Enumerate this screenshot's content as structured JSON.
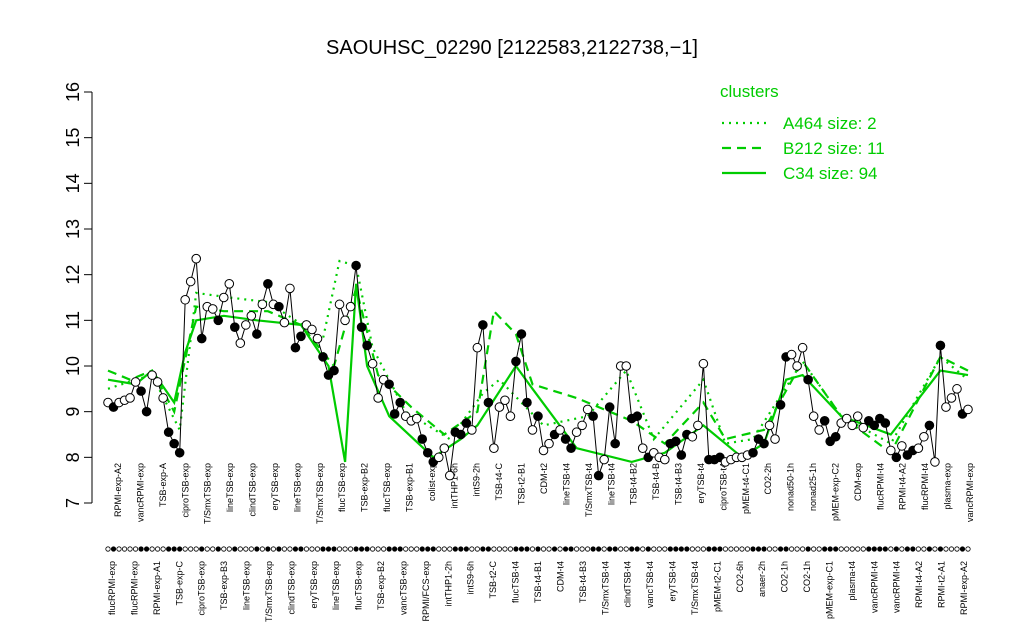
{
  "chart_data": {
    "type": "line",
    "title": "SAOUHSC_02290 [2122583,2122738,−1]",
    "xlabel": "",
    "ylabel": "",
    "ylim": [
      7,
      16
    ],
    "yticks": [
      "7",
      "8",
      "9",
      "10",
      "11",
      "12",
      "13",
      "14",
      "15",
      "16"
    ],
    "xtick_labels_lower": [
      "flucRPMI-exp",
      "flucRPMI-exp",
      "RPMI-exp-A1",
      "TSB-exp-C",
      "ciproTSB-exp",
      "TSB-exp-B3",
      "lineTSB-exp",
      "T/SmxTSB-exp",
      "clindTSB-exp",
      "eryTSB-exp",
      "lineTSB-exp",
      "flucTSB-exp",
      "TSB-exp-B2",
      "vancTSB-exp",
      "RPMI/FCS-exp",
      "intTHP1-2h",
      "intS9-6h",
      "TSB-t2-C",
      "flucTSB-t4",
      "TSB-t4-B1",
      "CDM-t4",
      "TSB-t4-B3",
      "T/SmxTSB-t4",
      "clindTSB-t4",
      "vancTSB-t4",
      "eryTSB-t4",
      "T/SmxTSB-t4",
      "pMEM-t2-C1",
      "CO2-6h",
      "anaer-2h",
      "CO2-1h",
      "CO2-1h",
      "pMEM-exp-C1",
      "plasma-t4",
      "vancRPMI-t4",
      "vancRPMI-t4",
      "RPMI-t4-A2",
      "RPMI-t2-A1",
      "RPMI-exp-A2"
    ],
    "xtick_labels_upper": [
      "RPMI-exp-A2",
      "vancRPMI-exp",
      "TSB-exp-A",
      "ciproTSB-exp",
      "T/SmxTSB-exp",
      "lineTSB-exp",
      "clindTSB-exp",
      "eryTSB-exp",
      "lineTSB-exp",
      "T/SmxTSB-exp",
      "flucTSB-exp",
      "TSB-exp-B2",
      "flucTSB-exp",
      "TSB-exp-B1",
      "colist-exp",
      "intTHP1-6h",
      "intS9-2h",
      "TSB-t4-C",
      "TSB-t2-B1",
      "CDM-t2",
      "lineTSB-t4",
      "T/SmxTSB-t4",
      "lineTSB-t4",
      "TSB-t4-B2",
      "TSB-t4-B",
      "TSB-t4-B3",
      "eryTSB-t4",
      "ciproTSB-t4",
      "pMEM-t4-C1",
      "CO2-2h",
      "nonad50-1h",
      "nonad25-1h",
      "pMEM-exp-C2",
      "CDM-exp",
      "flucRPMI-t4",
      "RPMI-t4-A2",
      "flucRPMI-t4",
      "plasma-exp",
      "vancRPMI-exp"
    ],
    "legend": {
      "title": "clusters",
      "position": "top-right",
      "entries": [
        {
          "label": "A464 size: 2",
          "style": "dotted",
          "color": "#00cc00"
        },
        {
          "label": "B212 size: 11",
          "style": "dashed",
          "color": "#00cc00"
        },
        {
          "label": "C34 size: 94",
          "style": "solid",
          "color": "#00cc00"
        }
      ]
    },
    "grid": false,
    "points": [
      [
        1,
        9.2,
        0
      ],
      [
        2,
        9.1,
        1
      ],
      [
        3,
        9.2,
        0
      ],
      [
        4,
        9.25,
        0
      ],
      [
        5,
        9.3,
        0
      ],
      [
        6,
        9.65,
        0
      ],
      [
        7,
        9.45,
        1
      ],
      [
        8,
        9.0,
        1
      ],
      [
        9,
        9.8,
        0
      ],
      [
        10,
        9.65,
        0
      ],
      [
        11,
        9.3,
        0
      ],
      [
        12,
        8.55,
        1
      ],
      [
        13,
        8.3,
        1
      ],
      [
        14,
        8.1,
        1
      ],
      [
        15,
        11.45,
        0
      ],
      [
        16,
        11.85,
        0
      ],
      [
        17,
        12.35,
        0
      ],
      [
        18,
        10.6,
        1
      ],
      [
        19,
        11.3,
        0
      ],
      [
        20,
        11.25,
        0
      ],
      [
        21,
        11.0,
        1
      ],
      [
        22,
        11.5,
        0
      ],
      [
        23,
        11.8,
        0
      ],
      [
        24,
        10.85,
        1
      ],
      [
        25,
        10.5,
        0
      ],
      [
        26,
        10.9,
        0
      ],
      [
        27,
        11.1,
        0
      ],
      [
        28,
        10.7,
        1
      ],
      [
        29,
        11.35,
        0
      ],
      [
        30,
        11.8,
        1
      ],
      [
        31,
        11.35,
        0
      ],
      [
        32,
        11.3,
        1
      ],
      [
        33,
        10.95,
        0
      ],
      [
        34,
        11.7,
        0
      ],
      [
        35,
        10.4,
        1
      ],
      [
        36,
        10.65,
        1
      ],
      [
        37,
        10.9,
        0
      ],
      [
        38,
        10.8,
        0
      ],
      [
        39,
        10.6,
        0
      ],
      [
        40,
        10.2,
        1
      ],
      [
        41,
        9.8,
        1
      ],
      [
        42,
        9.9,
        1
      ],
      [
        43,
        11.35,
        0
      ],
      [
        44,
        11.0,
        0
      ],
      [
        45,
        11.3,
        0
      ],
      [
        46,
        12.2,
        1
      ],
      [
        47,
        10.85,
        1
      ],
      [
        48,
        10.45,
        1
      ],
      [
        49,
        10.05,
        0
      ],
      [
        50,
        9.3,
        0
      ],
      [
        51,
        9.7,
        0
      ],
      [
        52,
        9.6,
        1
      ],
      [
        53,
        8.95,
        1
      ],
      [
        54,
        9.2,
        1
      ],
      [
        55,
        8.9,
        0
      ],
      [
        56,
        8.8,
        0
      ],
      [
        57,
        8.85,
        0
      ],
      [
        58,
        8.4,
        1
      ],
      [
        59,
        8.1,
        1
      ],
      [
        60,
        7.9,
        1
      ],
      [
        61,
        8.0,
        0
      ],
      [
        62,
        8.2,
        0
      ],
      [
        63,
        7.6,
        0
      ],
      [
        64,
        8.55,
        1
      ],
      [
        65,
        8.5,
        1
      ],
      [
        66,
        8.75,
        1
      ],
      [
        67,
        8.6,
        0
      ],
      [
        68,
        10.4,
        0
      ],
      [
        69,
        10.9,
        1
      ],
      [
        70,
        9.2,
        1
      ],
      [
        71,
        8.2,
        0
      ],
      [
        72,
        9.1,
        0
      ],
      [
        73,
        9.25,
        0
      ],
      [
        74,
        8.9,
        0
      ],
      [
        75,
        10.1,
        1
      ],
      [
        76,
        10.7,
        1
      ],
      [
        77,
        9.2,
        1
      ],
      [
        78,
        8.6,
        0
      ],
      [
        79,
        8.9,
        1
      ],
      [
        80,
        8.15,
        0
      ],
      [
        81,
        8.3,
        0
      ],
      [
        82,
        8.5,
        1
      ],
      [
        83,
        8.6,
        0
      ],
      [
        84,
        8.4,
        1
      ],
      [
        85,
        8.2,
        1
      ],
      [
        86,
        8.55,
        0
      ],
      [
        87,
        8.7,
        0
      ],
      [
        88,
        9.05,
        0
      ],
      [
        89,
        8.9,
        1
      ],
      [
        90,
        7.6,
        1
      ],
      [
        91,
        7.95,
        0
      ],
      [
        92,
        9.1,
        1
      ],
      [
        93,
        8.3,
        1
      ],
      [
        94,
        10.0,
        0
      ],
      [
        95,
        10.0,
        0
      ],
      [
        96,
        8.85,
        1
      ],
      [
        97,
        8.9,
        1
      ],
      [
        98,
        8.2,
        0
      ],
      [
        99,
        8.0,
        1
      ],
      [
        100,
        8.1,
        0
      ],
      [
        101,
        8.0,
        0
      ],
      [
        102,
        7.95,
        0
      ],
      [
        103,
        8.3,
        1
      ],
      [
        104,
        8.35,
        1
      ],
      [
        105,
        8.05,
        1
      ],
      [
        106,
        8.5,
        1
      ],
      [
        107,
        8.45,
        0
      ],
      [
        108,
        8.7,
        0
      ],
      [
        109,
        10.05,
        0
      ],
      [
        110,
        7.95,
        1
      ],
      [
        111,
        7.95,
        1
      ],
      [
        112,
        8.0,
        1
      ],
      [
        113,
        7.9,
        0
      ],
      [
        114,
        7.95,
        0
      ],
      [
        115,
        8.0,
        0
      ],
      [
        116,
        8.0,
        0
      ],
      [
        117,
        8.05,
        0
      ],
      [
        118,
        8.1,
        1
      ],
      [
        119,
        8.4,
        1
      ],
      [
        120,
        8.3,
        1
      ],
      [
        121,
        8.7,
        0
      ],
      [
        122,
        8.4,
        0
      ],
      [
        123,
        9.15,
        1
      ],
      [
        124,
        10.2,
        1
      ],
      [
        125,
        10.25,
        0
      ],
      [
        126,
        10.0,
        0
      ],
      [
        127,
        10.4,
        0
      ],
      [
        128,
        9.7,
        1
      ],
      [
        129,
        8.9,
        0
      ],
      [
        130,
        8.6,
        0
      ],
      [
        131,
        8.8,
        1
      ],
      [
        132,
        8.35,
        1
      ],
      [
        133,
        8.45,
        1
      ],
      [
        134,
        8.75,
        0
      ],
      [
        135,
        8.85,
        0
      ],
      [
        136,
        8.7,
        0
      ],
      [
        137,
        8.9,
        0
      ],
      [
        138,
        8.65,
        0
      ],
      [
        139,
        8.8,
        1
      ],
      [
        140,
        8.7,
        1
      ],
      [
        141,
        8.85,
        1
      ],
      [
        142,
        8.75,
        1
      ],
      [
        143,
        8.15,
        0
      ],
      [
        144,
        8.0,
        1
      ],
      [
        145,
        8.25,
        0
      ],
      [
        146,
        8.05,
        1
      ],
      [
        147,
        8.15,
        1
      ],
      [
        148,
        8.2,
        0
      ],
      [
        149,
        8.45,
        0
      ],
      [
        150,
        8.7,
        1
      ],
      [
        151,
        7.9,
        0
      ],
      [
        152,
        10.45,
        1
      ],
      [
        153,
        9.1,
        0
      ],
      [
        154,
        9.3,
        0
      ],
      [
        155,
        9.5,
        0
      ],
      [
        156,
        8.95,
        1
      ],
      [
        157,
        9.05,
        0
      ]
    ],
    "series": [
      {
        "style": "dotted",
        "values": [
          [
            1,
            9.5
          ],
          [
            6,
            9.7
          ],
          [
            9,
            9.8
          ],
          [
            14,
            8.6
          ],
          [
            17,
            11.6
          ],
          [
            23,
            11.5
          ],
          [
            30,
            11.4
          ],
          [
            35,
            11.0
          ],
          [
            40,
            10.6
          ],
          [
            43,
            12.3
          ],
          [
            46,
            12.2
          ],
          [
            49,
            10.4
          ],
          [
            55,
            9.0
          ],
          [
            63,
            8.4
          ],
          [
            69,
            9.4
          ],
          [
            72,
            9.7
          ],
          [
            80,
            8.7
          ],
          [
            88,
            8.9
          ],
          [
            95,
            9.9
          ],
          [
            100,
            8.4
          ],
          [
            109,
            9.7
          ],
          [
            113,
            8.3
          ],
          [
            118,
            8.4
          ],
          [
            127,
            10.1
          ],
          [
            134,
            8.9
          ],
          [
            143,
            8.3
          ],
          [
            152,
            10.2
          ],
          [
            157,
            9.7
          ]
        ]
      },
      {
        "style": "dashed",
        "values": [
          [
            1,
            9.9
          ],
          [
            5,
            9.7
          ],
          [
            9,
            9.9
          ],
          [
            13,
            9.0
          ],
          [
            17,
            11.3
          ],
          [
            22,
            11.2
          ],
          [
            30,
            11.2
          ],
          [
            36,
            10.9
          ],
          [
            42,
            10.0
          ],
          [
            46,
            11.7
          ],
          [
            50,
            9.8
          ],
          [
            56,
            9.1
          ],
          [
            62,
            8.5
          ],
          [
            68,
            9.0
          ],
          [
            71,
            11.2
          ],
          [
            75,
            10.7
          ],
          [
            78,
            9.6
          ],
          [
            86,
            9.3
          ],
          [
            92,
            9.0
          ],
          [
            96,
            8.8
          ],
          [
            102,
            8.3
          ],
          [
            109,
            9.2
          ],
          [
            113,
            8.4
          ],
          [
            120,
            8.6
          ],
          [
            127,
            10.1
          ],
          [
            134,
            8.9
          ],
          [
            143,
            8.1
          ],
          [
            152,
            10.2
          ],
          [
            157,
            9.9
          ]
        ]
      },
      {
        "style": "solid",
        "values": [
          [
            1,
            9.7
          ],
          [
            6,
            9.6
          ],
          [
            9,
            9.9
          ],
          [
            13,
            9.2
          ],
          [
            15,
            10.3
          ],
          [
            17,
            11.0
          ],
          [
            22,
            11.1
          ],
          [
            28,
            11.0
          ],
          [
            36,
            10.9
          ],
          [
            41,
            10.0
          ],
          [
            44,
            7.9
          ],
          [
            46,
            11.8
          ],
          [
            48,
            10.0
          ],
          [
            52,
            8.9
          ],
          [
            60,
            8.0
          ],
          [
            65,
            8.4
          ],
          [
            68,
            8.7
          ],
          [
            75,
            10.0
          ],
          [
            78,
            9.5
          ],
          [
            86,
            8.2
          ],
          [
            96,
            7.9
          ],
          [
            102,
            8.1
          ],
          [
            109,
            8.7
          ],
          [
            116,
            8.0
          ],
          [
            120,
            8.3
          ],
          [
            124,
            9.7
          ],
          [
            127,
            9.8
          ],
          [
            134,
            8.9
          ],
          [
            143,
            8.5
          ],
          [
            152,
            9.9
          ],
          [
            157,
            9.8
          ]
        ]
      }
    ]
  }
}
